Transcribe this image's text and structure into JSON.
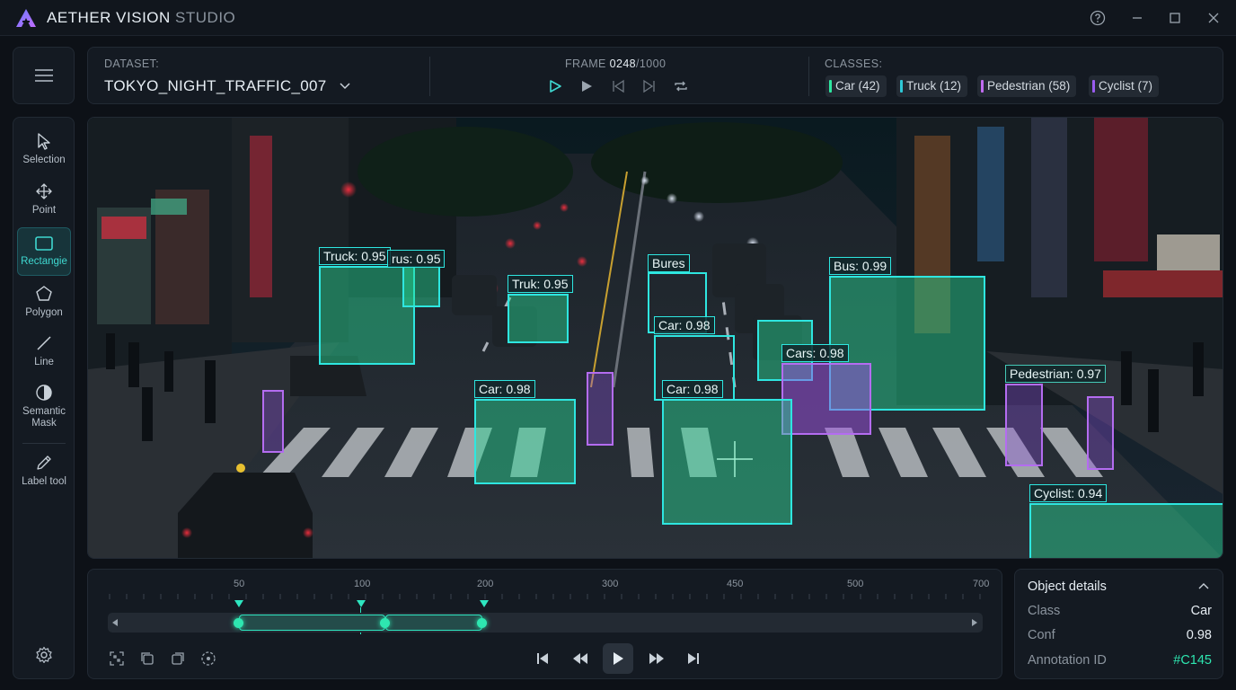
{
  "app": {
    "title_main": "AETHER VISION",
    "title_sub": " STUDIO"
  },
  "toolbar": {
    "tools": [
      {
        "label": "Selection",
        "icon": "cursor-icon"
      },
      {
        "label": "Point",
        "icon": "move-arrows-icon"
      },
      {
        "label": "Rectangie",
        "icon": "rectangle-icon",
        "active": true
      },
      {
        "label": "Polygon",
        "icon": "pentagon-icon"
      },
      {
        "label": "Line",
        "icon": "line-icon"
      },
      {
        "label": "Semantic Mask",
        "icon": "half-circle-icon"
      },
      {
        "label": "Label tool",
        "icon": "pencil-icon"
      }
    ]
  },
  "header": {
    "dataset_label": "DATASET:",
    "dataset_name": "TOKYO_NIGHT_TRAFFIC_007",
    "frame_label": "FRAME",
    "frame_current": "0248",
    "frame_total": "/1000",
    "classes_label": "CLASSES:",
    "classes": [
      {
        "label": "Car (42)",
        "color": "#2ee6a0"
      },
      {
        "label": "Truck (12)",
        "color": "#2ec8d6"
      },
      {
        "label": "Pedestrian (58)",
        "color": "#c06cf0"
      },
      {
        "label": "Cyclist (7)",
        "color": "#9a5cf0"
      }
    ]
  },
  "annotations": {
    "truck1": "Truck: 0.95",
    "bus_partial": "rus: 0.95",
    "truk": "Truk: 0.95",
    "bures": "Bures",
    "bus": "Bus: 0.99",
    "car1": "Car: 0.98",
    "cars": "Cars: 0.98",
    "car2": "Car: 0.98",
    "car3": "Car: 0.98",
    "pedestrian": "Pedestrian: 0.97",
    "cyclist": "Cyclist: 0.94"
  },
  "timeline": {
    "ticks": [
      "50",
      "100",
      "200",
      "300",
      "450",
      "500",
      "700"
    ]
  },
  "details": {
    "title": "Object details",
    "class_label": "Class",
    "class_value": "Car",
    "conf_label": "Conf",
    "conf_value": "0.98",
    "id_label": "Annotation ID",
    "id_value": "#C145",
    "id_color": "#2ee6b0"
  }
}
